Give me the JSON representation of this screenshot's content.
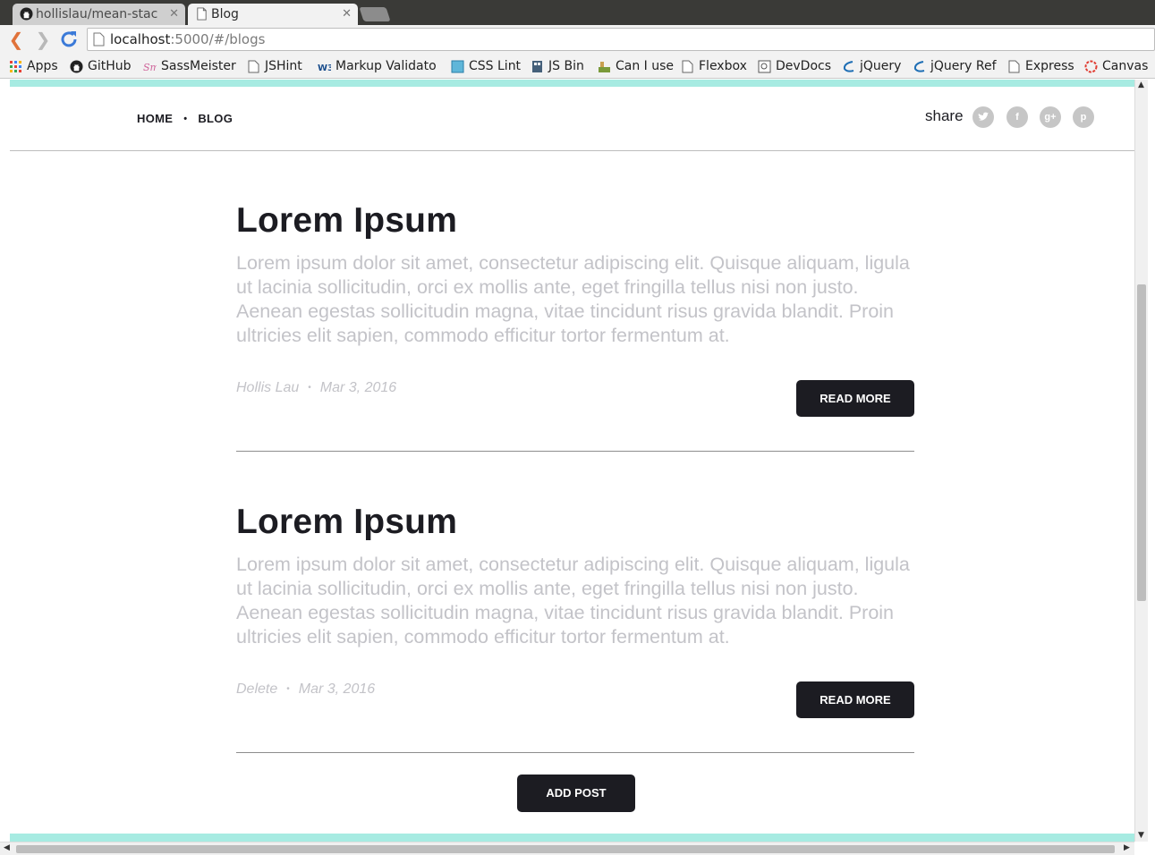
{
  "browser": {
    "tabs": [
      {
        "label": "hollislau/mean-stac",
        "active": false,
        "icon": "github-icon"
      },
      {
        "label": "Blog",
        "active": true,
        "icon": "page-icon"
      }
    ],
    "url_host": "localhost",
    "url_path": ":5000/#/blogs",
    "bookmarks": [
      {
        "label": "Apps",
        "icon": "apps-grid-icon"
      },
      {
        "label": "GitHub",
        "icon": "github-icon"
      },
      {
        "label": "SassMeister",
        "icon": "sassmeister-icon"
      },
      {
        "label": "JSHint",
        "icon": "page-icon"
      },
      {
        "label": "Markup Validato",
        "icon": "w3c-icon"
      },
      {
        "label": "CSS Lint",
        "icon": "csslint-icon"
      },
      {
        "label": "JS Bin",
        "icon": "jsbin-icon"
      },
      {
        "label": "Can I use",
        "icon": "caniuse-icon"
      },
      {
        "label": "Flexbox",
        "icon": "page-icon"
      },
      {
        "label": "DevDocs",
        "icon": "devdocs-icon"
      },
      {
        "label": "jQuery",
        "icon": "jquery-icon"
      },
      {
        "label": "jQuery Ref",
        "icon": "jquery-icon"
      },
      {
        "label": "Express",
        "icon": "page-icon"
      },
      {
        "label": "Canvas",
        "icon": "canvas-icon"
      }
    ]
  },
  "site": {
    "nav": {
      "home": "HOME",
      "separator": "•",
      "blog": "BLOG"
    },
    "share_label": "share",
    "social_icons": [
      "twitter-icon",
      "facebook-icon",
      "google-plus-icon",
      "pinterest-icon"
    ],
    "accent_color": "#a7ebe2",
    "button_color": "#1c1c22"
  },
  "posts": [
    {
      "title": "Lorem Ipsum",
      "body": "Lorem ipsum dolor sit amet, consectetur adipiscing elit. Quisque aliquam, ligula ut lacinia sollicitudin, orci ex mollis ante, eget fringilla tellus nisi non justo. Aenean egestas sollicitudin magna, vitae tincidunt risus gravida blandit. Proin ultricies elit sapien, commodo efficitur tortor fermentum at.",
      "author": "Hollis Lau",
      "separator": "•",
      "date": "Mar 3, 2016",
      "read_more": "READ MORE"
    },
    {
      "title": "Lorem Ipsum",
      "body": "Lorem ipsum dolor sit amet, consectetur adipiscing elit. Quisque aliquam, ligula ut lacinia sollicitudin, orci ex mollis ante, eget fringilla tellus nisi non justo. Aenean egestas sollicitudin magna, vitae tincidunt risus gravida blandit. Proin ultricies elit sapien, commodo efficitur tortor fermentum at.",
      "author": "Delete",
      "separator": "•",
      "date": "Mar 3, 2016",
      "read_more": "READ MORE"
    }
  ],
  "add_post_label": "ADD POST"
}
